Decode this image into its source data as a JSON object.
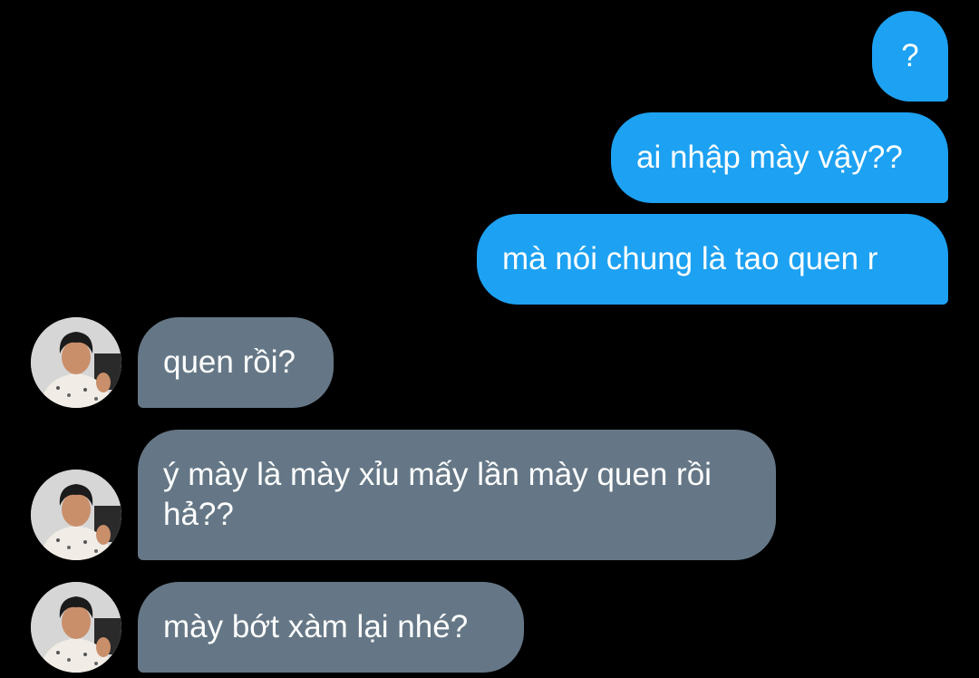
{
  "conversation": {
    "messages": [
      {
        "direction": "sent",
        "text": "?"
      },
      {
        "direction": "sent",
        "text": "ai nhập mày vậy??"
      },
      {
        "direction": "sent",
        "text": "mà nói chung là tao quen r"
      },
      {
        "direction": "received",
        "text": "quen rồi?"
      },
      {
        "direction": "received",
        "text": "ý mày là mày xỉu mấy lần mày quen rồi hả??"
      },
      {
        "direction": "received",
        "text": "mày bớt xàm lại nhé?"
      }
    ]
  },
  "colors": {
    "background": "#000000",
    "sent_bubble": "#1da1f2",
    "received_bubble": "#657786",
    "text": "#ffffff"
  },
  "icons": {
    "avatar": "contact-avatar-photo"
  }
}
